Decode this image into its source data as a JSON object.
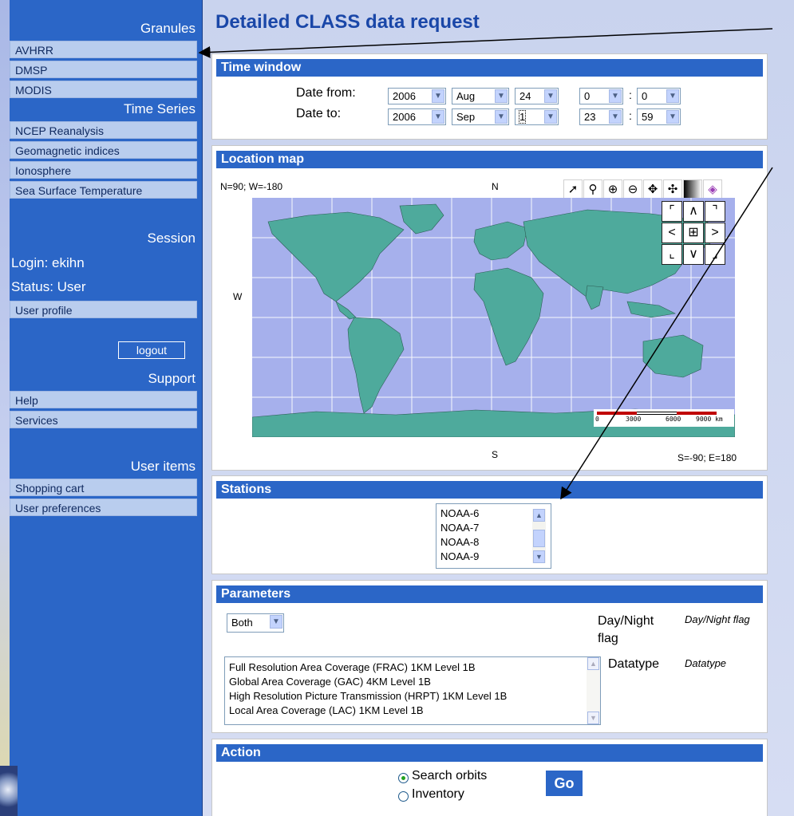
{
  "page": {
    "title": "Detailed CLASS data request"
  },
  "sidebar": {
    "granules": {
      "title": "Granules",
      "items": [
        "AVHRR",
        "DMSP",
        "MODIS"
      ]
    },
    "time_series": {
      "title": "Time Series",
      "items": [
        "NCEP Reanalysis",
        "Geomagnetic indices",
        "Ionosphere",
        "Sea Surface Temperature"
      ]
    },
    "session": {
      "title": "Session",
      "login": "Login: ekihn",
      "status": "Status:  User",
      "profile": "User profile",
      "logout": "logout"
    },
    "support": {
      "title": "Support",
      "items": [
        "Help",
        "Services"
      ]
    },
    "user_items": {
      "title": "User items",
      "items": [
        "Shopping cart",
        "User preferences"
      ]
    }
  },
  "time_window": {
    "title": "Time window",
    "from_label": "Date from:",
    "to_label": "Date to:",
    "from": {
      "year": "2006",
      "month": "Aug",
      "day": "24",
      "hour": "0",
      "minute": "0"
    },
    "to": {
      "year": "2006",
      "month": "Sep",
      "day": "1",
      "hour": "23",
      "minute": "59"
    },
    "separator": ":"
  },
  "location_map": {
    "title": "Location map",
    "top_left": "N=90; W=-180",
    "north": "N",
    "west": "W",
    "south": "S",
    "bottom_right": "S=-90; E=180",
    "scale_ticks": [
      "0",
      "3000",
      "6000",
      "9000 km"
    ],
    "tools": [
      "select-arrow-icon",
      "search-icon",
      "zoom-in-icon",
      "zoom-out-icon",
      "pan-icon",
      "recenter-icon",
      "grayscale-icon",
      "layers-icon"
    ],
    "ocean_color": "#a6b0ec",
    "land_color": "#4eaa9c"
  },
  "stations": {
    "title": "Stations",
    "options": [
      "NOAA-6",
      "NOAA-7",
      "NOAA-8",
      "NOAA-9"
    ]
  },
  "parameters": {
    "title": "Parameters",
    "day_night_value": "Both",
    "day_night_label": "Day/Night flag",
    "day_night_hint": "Day/Night flag",
    "datatype_label": "Datatype",
    "datatype_hint": "Datatype",
    "datatype_options": [
      "Full Resolution Area Coverage (FRAC) 1KM Level 1B",
      "Global Area Coverage (GAC) 4KM Level 1B",
      "High Resolution Picture Transmission (HRPT) 1KM Level 1B",
      "Local Area Coverage (LAC) 1KM Level 1B"
    ]
  },
  "action": {
    "title": "Action",
    "search_orbits": "Search orbits",
    "inventory": "Inventory",
    "go": "Go"
  },
  "colors": {
    "accent": "#2b66c7",
    "sidebar_item": "#b9cdee",
    "title": "#1a47a8"
  }
}
